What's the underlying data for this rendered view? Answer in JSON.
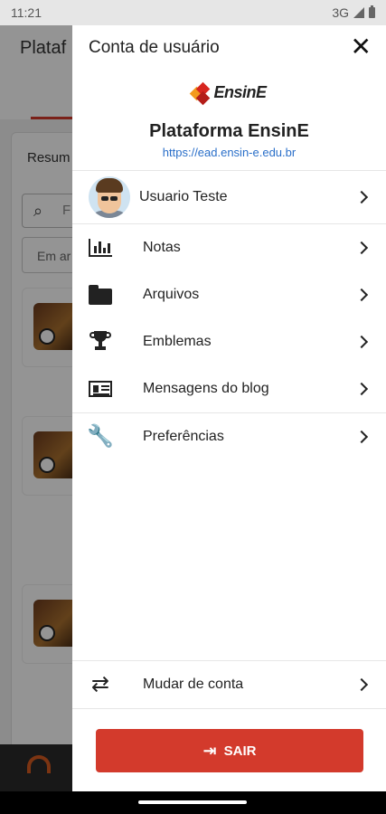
{
  "status_bar": {
    "time": "11:21",
    "network": "3G"
  },
  "background": {
    "title": "Plataf",
    "section": "Resum",
    "search_placeholder": "F",
    "select_value": "Em ar"
  },
  "drawer": {
    "title": "Conta de usuário",
    "close_icon": "close-icon",
    "logo_text": "EnsinE",
    "site_name": "Plataforma EnsinE",
    "site_url": "https://ead.ensin-e.edu.br",
    "user": {
      "name": "Usuario Teste"
    },
    "menu": [
      {
        "label": "Notas",
        "icon": "bar-chart-icon"
      },
      {
        "label": "Arquivos",
        "icon": "folder-icon"
      },
      {
        "label": "Emblemas",
        "icon": "trophy-icon"
      },
      {
        "label": "Mensagens do blog",
        "icon": "newspaper-icon"
      },
      {
        "label": "Preferências",
        "icon": "wrench-icon"
      }
    ],
    "switch_account": {
      "label": "Mudar de conta",
      "icon": "swap-icon"
    },
    "logout": {
      "label": "SAIR",
      "icon": "logout-icon"
    }
  },
  "colors": {
    "accent": "#d33a2c",
    "link": "#2a6fc9"
  }
}
